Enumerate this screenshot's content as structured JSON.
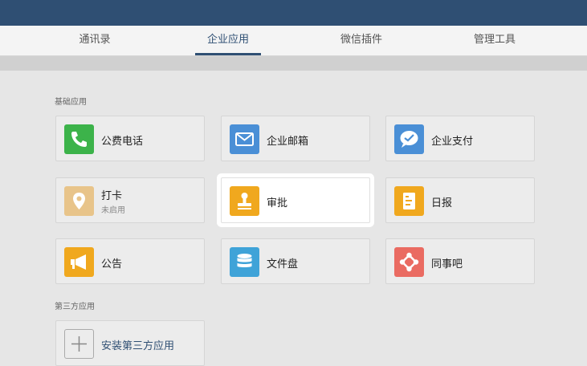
{
  "tabs": [
    {
      "label": "通讯录"
    },
    {
      "label": "企业应用"
    },
    {
      "label": "微信插件"
    },
    {
      "label": "管理工具"
    }
  ],
  "sections": {
    "basic": "基础应用",
    "third_party": "第三方应用"
  },
  "apps": [
    {
      "name": "公费电话",
      "icon": "phone-icon",
      "color": "#3cb34a"
    },
    {
      "name": "企业邮箱",
      "icon": "mail-icon",
      "color": "#4a8fd6"
    },
    {
      "name": "企业支付",
      "icon": "payment-chat-icon",
      "color": "#4a8fd6"
    },
    {
      "name": "打卡",
      "sub": "未启用",
      "icon": "location-pin-icon",
      "color": "#e8c48a"
    },
    {
      "name": "审批",
      "icon": "stamp-icon",
      "color": "#f0a81e"
    },
    {
      "name": "日报",
      "icon": "report-icon",
      "color": "#f0a81e"
    },
    {
      "name": "公告",
      "icon": "megaphone-icon",
      "color": "#f0a81e"
    },
    {
      "name": "文件盘",
      "icon": "database-icon",
      "color": "#3fa3d8"
    },
    {
      "name": "同事吧",
      "icon": "network-icon",
      "color": "#ea6b62"
    }
  ],
  "install": {
    "label": "安装第三方应用",
    "icon": "plus-icon"
  }
}
